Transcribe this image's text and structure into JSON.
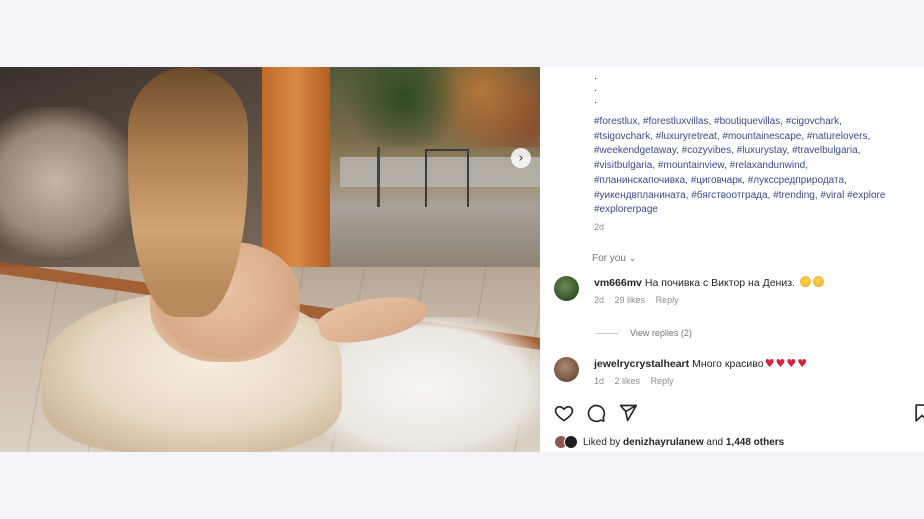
{
  "post": {
    "hashtags_lines": [
      "#forestlux, #forestluxvillas, #boutiquevillas, #cigovchark,",
      "#tsigovchark, #luxuryretreat, #mountainescape, #naturelovers,",
      "#weekendgetaway, #cozyvibes, #luxurystay, #travelbulgaria,",
      "#visitbulgaria, #mountainview, #relaxandunwind,",
      "#планинскапочивка, #циговчарк, #лукссредприродата,",
      "#уикендвпланината, #бягствоотградa, #trending, #viral #explore",
      "#explorerpage"
    ],
    "dots": [
      ".",
      ".",
      "."
    ],
    "age": "2d",
    "for_you_label": "For you"
  },
  "comments": [
    {
      "user": "vm666mv",
      "text": "На почивка с Виктор на Дениз.",
      "age": "2d",
      "likes": "29 likes",
      "reply_label": "Reply",
      "view_replies": "View replies (2)",
      "avatar_color": "#3a5a2f"
    },
    {
      "user": "jewelrycrystalheart",
      "text": "Много красиво",
      "age": "1d",
      "likes": "2 likes",
      "reply_label": "Reply",
      "avatar_color": "#7a5a48"
    }
  ],
  "likes_summary": {
    "prefix": "Liked by",
    "user": "denizhayrulanew",
    "connector": "and",
    "others": "1,448 others"
  },
  "icons": [
    "heart-icon",
    "comment-icon",
    "share-icon",
    "bookmark-icon",
    "next-arrow-icon"
  ],
  "colors": {
    "hashtag": "#3b4b8c",
    "heart": "#d1233a",
    "muted": "#8e8e8e"
  }
}
